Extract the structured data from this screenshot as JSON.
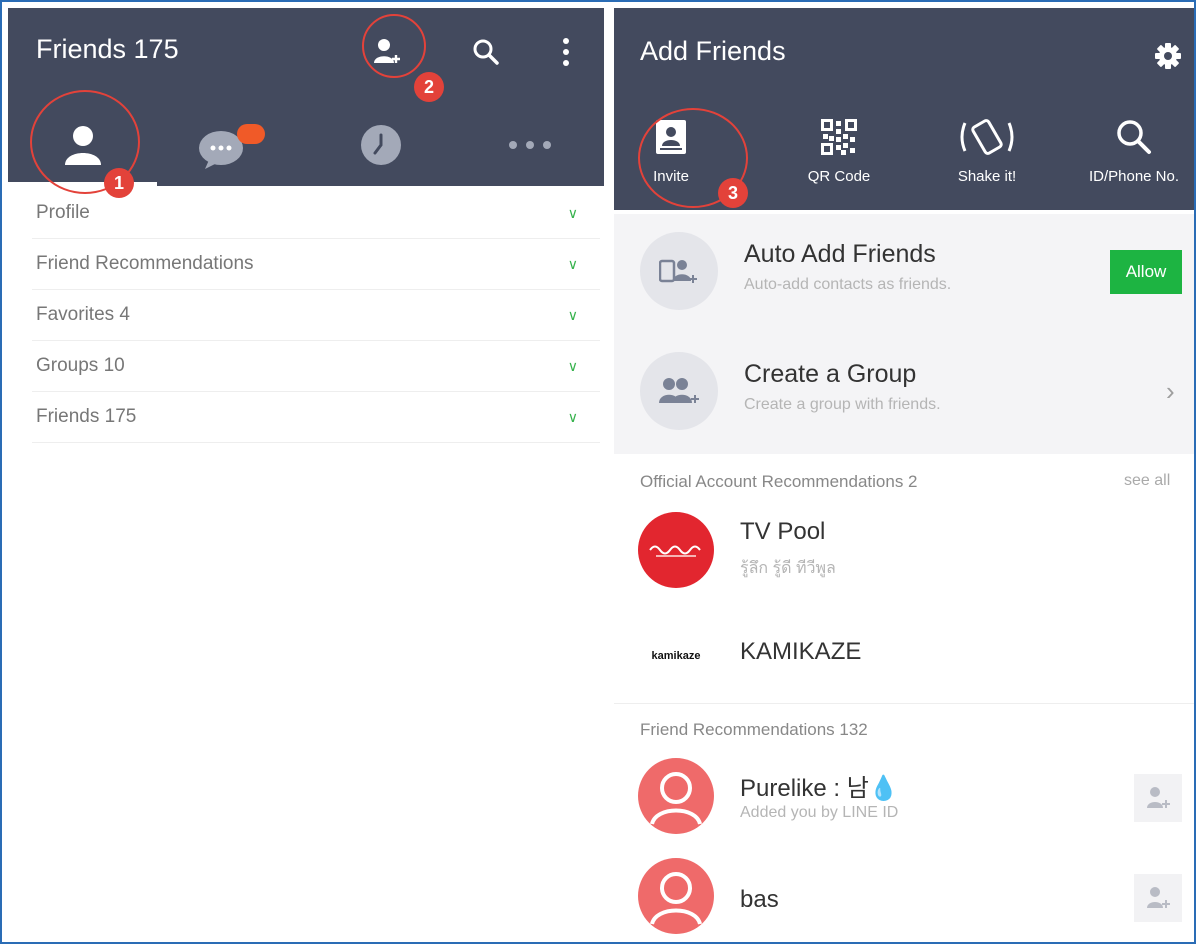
{
  "left_panel": {
    "title": "Friends 175",
    "header_icons": [
      "add-friend-icon",
      "search-icon",
      "more-vertical-icon"
    ],
    "tabs": [
      "friends-tab-icon",
      "chats-tab-icon",
      "timeline-tab-icon",
      "more-tab-icon"
    ],
    "menu_items": [
      {
        "label": "Profile"
      },
      {
        "label": "Friend Recommendations"
      },
      {
        "label": "Favorites 4"
      },
      {
        "label": "Groups 10"
      },
      {
        "label": "Friends 175"
      }
    ]
  },
  "right_panel": {
    "title": "Add Friends",
    "actions": [
      {
        "label": "Invite",
        "icon": "contact-book-icon"
      },
      {
        "label": "QR Code",
        "icon": "qr-code-icon"
      },
      {
        "label": "Shake it!",
        "icon": "shake-phone-icon"
      },
      {
        "label": "ID/Phone No.",
        "icon": "search-icon"
      }
    ],
    "auto_add": {
      "title": "Auto Add Friends",
      "subtitle": "Auto-add contacts as friends.",
      "button": "Allow"
    },
    "create_group": {
      "title": "Create a Group",
      "subtitle": "Create a group with friends."
    },
    "official_section": {
      "header": "Official Account Recommendations 2",
      "see_all": "see all"
    },
    "official_accounts": [
      {
        "name": "TV Pool",
        "subtitle": "รู้ลึก รู้ดี ทีวีพูล"
      },
      {
        "name": "KAMIKAZE",
        "logo_text": "kamikaze"
      }
    ],
    "friend_section": {
      "header": "Friend Recommendations 132"
    },
    "friend_recommendations": [
      {
        "name": "Purelike : 남💧",
        "subtitle": "Added you by LINE ID"
      },
      {
        "name": "bas"
      }
    ]
  },
  "annotations": [
    "1",
    "2",
    "3"
  ],
  "colors": {
    "header_bg": "#434a5e",
    "accent_green": "#1db442",
    "annotation_red": "#e3423a",
    "frame_blue": "#2a6cb5"
  }
}
